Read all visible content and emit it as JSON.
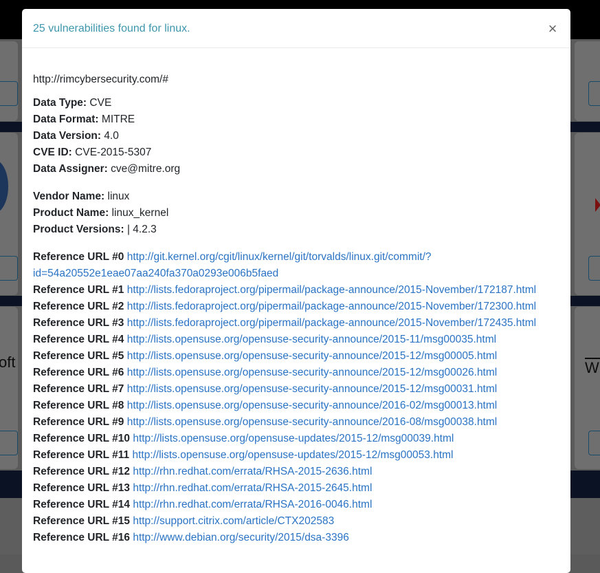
{
  "modal": {
    "title": "25 vulnerabilities found for linux.",
    "close_label": "×",
    "site_url": "http://rimcybersecurity.com/#",
    "meta": [
      {
        "label": "Data Type:",
        "value": "CVE"
      },
      {
        "label": "Data Format:",
        "value": "MITRE"
      },
      {
        "label": "Data Version:",
        "value": "4.0"
      },
      {
        "label": "CVE ID:",
        "value": "CVE-2015-5307"
      },
      {
        "label": "Data Assigner:",
        "value": "cve@mitre.org"
      }
    ],
    "product": [
      {
        "label": "Vendor Name:",
        "value": "linux"
      },
      {
        "label": "Product Name:",
        "value": "linux_kernel"
      },
      {
        "label": "Product Versions:",
        "value": "| 4.2.3"
      }
    ],
    "references": [
      {
        "label": "Reference URL #0",
        "url_line1": "http://git.kernel.org/cgit/linux/kernel/git/torvalds/linux.git/commit/?",
        "url_line2": "id=54a20552e1eae07aa240fa370a0293e006b5faed"
      },
      {
        "label": "Reference URL #1",
        "url_line1": "http://lists.fedoraproject.org/pipermail/package-announce/2015-November/172187.html"
      },
      {
        "label": "Reference URL #2",
        "url_line1": "http://lists.fedoraproject.org/pipermail/package-announce/2015-November/172300.html"
      },
      {
        "label": "Reference URL #3",
        "url_line1": "http://lists.fedoraproject.org/pipermail/package-announce/2015-November/172435.html"
      },
      {
        "label": "Reference URL #4",
        "url_line1": "http://lists.opensuse.org/opensuse-security-announce/2015-11/msg00035.html"
      },
      {
        "label": "Reference URL #5",
        "url_line1": "http://lists.opensuse.org/opensuse-security-announce/2015-12/msg00005.html"
      },
      {
        "label": "Reference URL #6",
        "url_line1": "http://lists.opensuse.org/opensuse-security-announce/2015-12/msg00026.html"
      },
      {
        "label": "Reference URL #7",
        "url_line1": "http://lists.opensuse.org/opensuse-security-announce/2015-12/msg00031.html"
      },
      {
        "label": "Reference URL #8",
        "url_line1": "http://lists.opensuse.org/opensuse-security-announce/2016-02/msg00013.html"
      },
      {
        "label": "Reference URL #9",
        "url_line1": "http://lists.opensuse.org/opensuse-security-announce/2016-08/msg00038.html"
      },
      {
        "label": "Reference URL #10",
        "url_line1": "http://lists.opensuse.org/opensuse-updates/2015-12/msg00039.html"
      },
      {
        "label": "Reference URL #11",
        "url_line1": "http://lists.opensuse.org/opensuse-updates/2015-12/msg00053.html"
      },
      {
        "label": "Reference URL #12",
        "url_line1": "http://rhn.redhat.com/errata/RHSA-2015-2636.html"
      },
      {
        "label": "Reference URL #13",
        "url_line1": "http://rhn.redhat.com/errata/RHSA-2015-2645.html"
      },
      {
        "label": "Reference URL #14",
        "url_line1": "http://rhn.redhat.com/errata/RHSA-2016-0046.html"
      },
      {
        "label": "Reference URL #15",
        "url_line1": "http://support.citrix.com/article/CTX202583"
      },
      {
        "label": "Reference URL #16",
        "url_line1": "http://www.debian.org/security/2015/dsa-3396"
      }
    ]
  },
  "background": {
    "left_partial_text": "oft",
    "right_partial_text": "WI"
  },
  "colors": {
    "title": "#3e96ad",
    "link": "#2a73c4",
    "overlay": "#5a5a5a"
  }
}
